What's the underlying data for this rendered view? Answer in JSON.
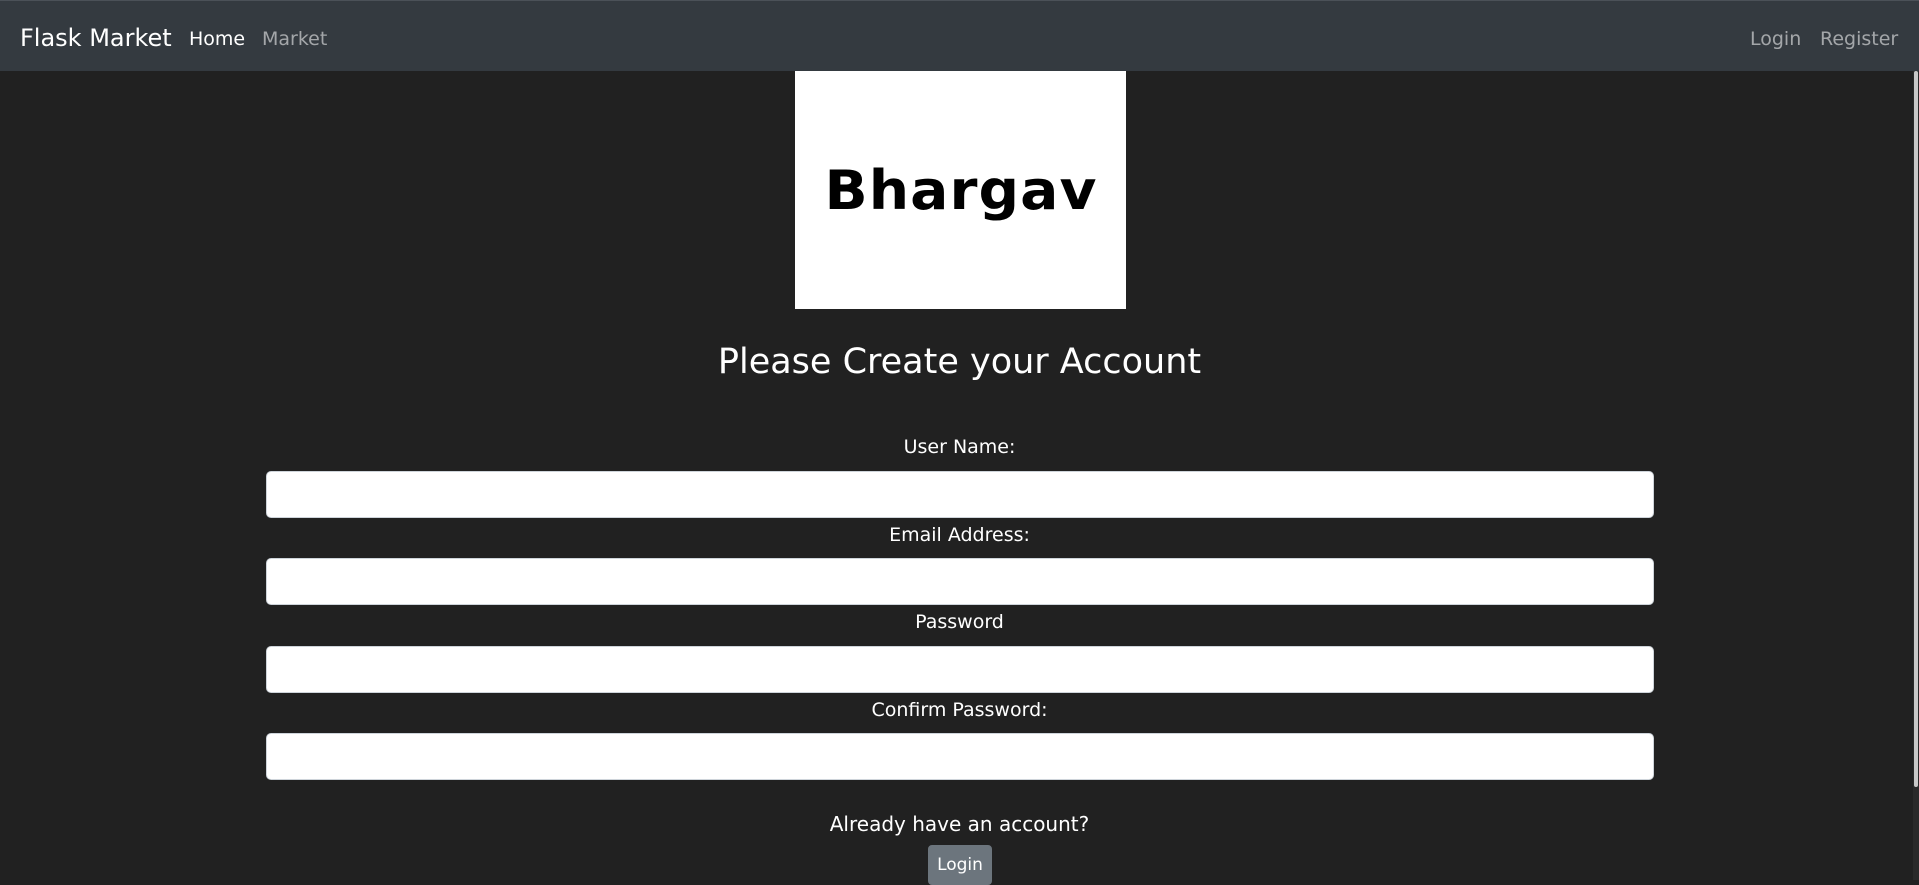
{
  "navbar": {
    "brand": "Flask Market",
    "left_links": [
      {
        "label": "Home",
        "active": true
      },
      {
        "label": "Market",
        "active": false
      }
    ],
    "right_links": [
      {
        "label": "Login"
      },
      {
        "label": "Register"
      }
    ]
  },
  "logo": {
    "text": "Bhargav"
  },
  "form": {
    "title": "Please Create your Account",
    "fields": [
      {
        "label": "User Name:",
        "value": "",
        "placeholder": ""
      },
      {
        "label": "Email Address:",
        "value": "",
        "placeholder": ""
      },
      {
        "label": "Password",
        "value": "",
        "placeholder": ""
      },
      {
        "label": "Confirm Password:",
        "value": "",
        "placeholder": ""
      }
    ],
    "already_text": "Already have an account?",
    "login_button": "Login"
  },
  "colors": {
    "background": "#212121",
    "navbar": "#343a40",
    "button_secondary": "#6c757d"
  }
}
